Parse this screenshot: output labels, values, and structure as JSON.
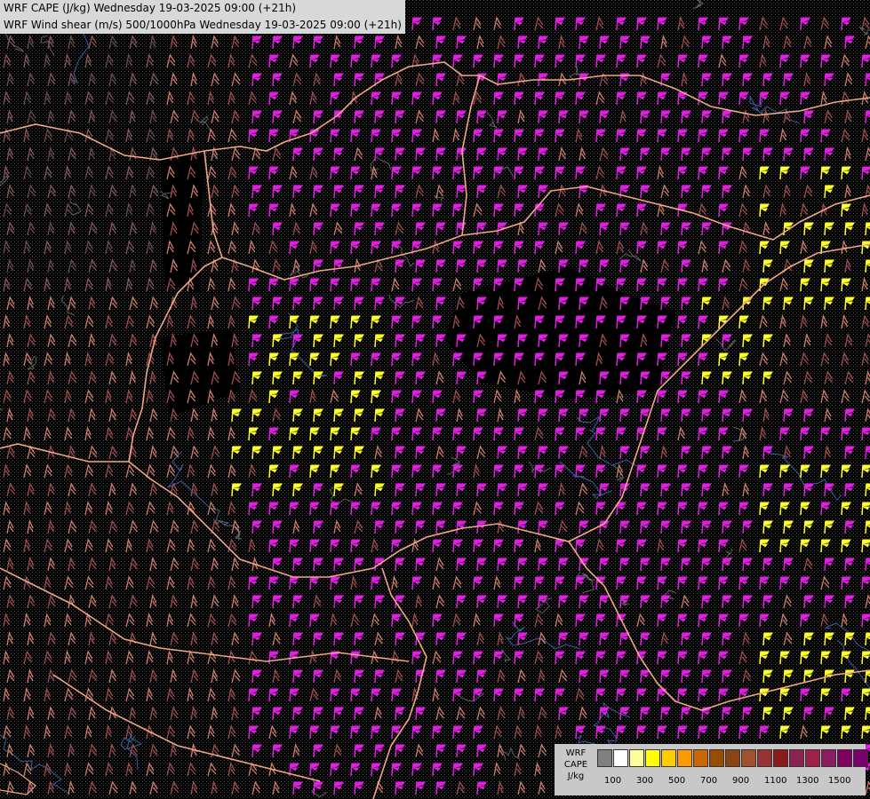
{
  "header": {
    "line1": "WRF CAPE (J/kg) Wednesday 19-03-2025 09:00 (+21h)",
    "line2": "WRF Wind shear (m/s) 500/1000hPa Wednesday 19-03-2025 09:00 (+21h)"
  },
  "legend": {
    "label_lines": [
      "WRF",
      "CAPE",
      "J/kg"
    ],
    "swatch_colors": [
      "#808080",
      "#ffffff",
      "#ffff99",
      "#ffff00",
      "#ffcc00",
      "#ff9900",
      "#cc6600",
      "#994c00",
      "#8b4513",
      "#a0522d",
      "#993333",
      "#8b1a1a",
      "#8b2252",
      "#a0204a",
      "#8b1c62",
      "#800060",
      "#7a0070"
    ],
    "tick_labels": [
      "100",
      "300",
      "500",
      "700",
      "900",
      "1100",
      "1300",
      "1500"
    ]
  },
  "map": {
    "description_colors": {
      "background": "#000000",
      "border": "#e8a080",
      "river": "#4060a0",
      "contour": "#b0b0b0",
      "barb_low": "#d08070",
      "barb_mid": "#a05050",
      "barb_high": "#e020e0",
      "barb_cape": "#ffff30"
    }
  }
}
